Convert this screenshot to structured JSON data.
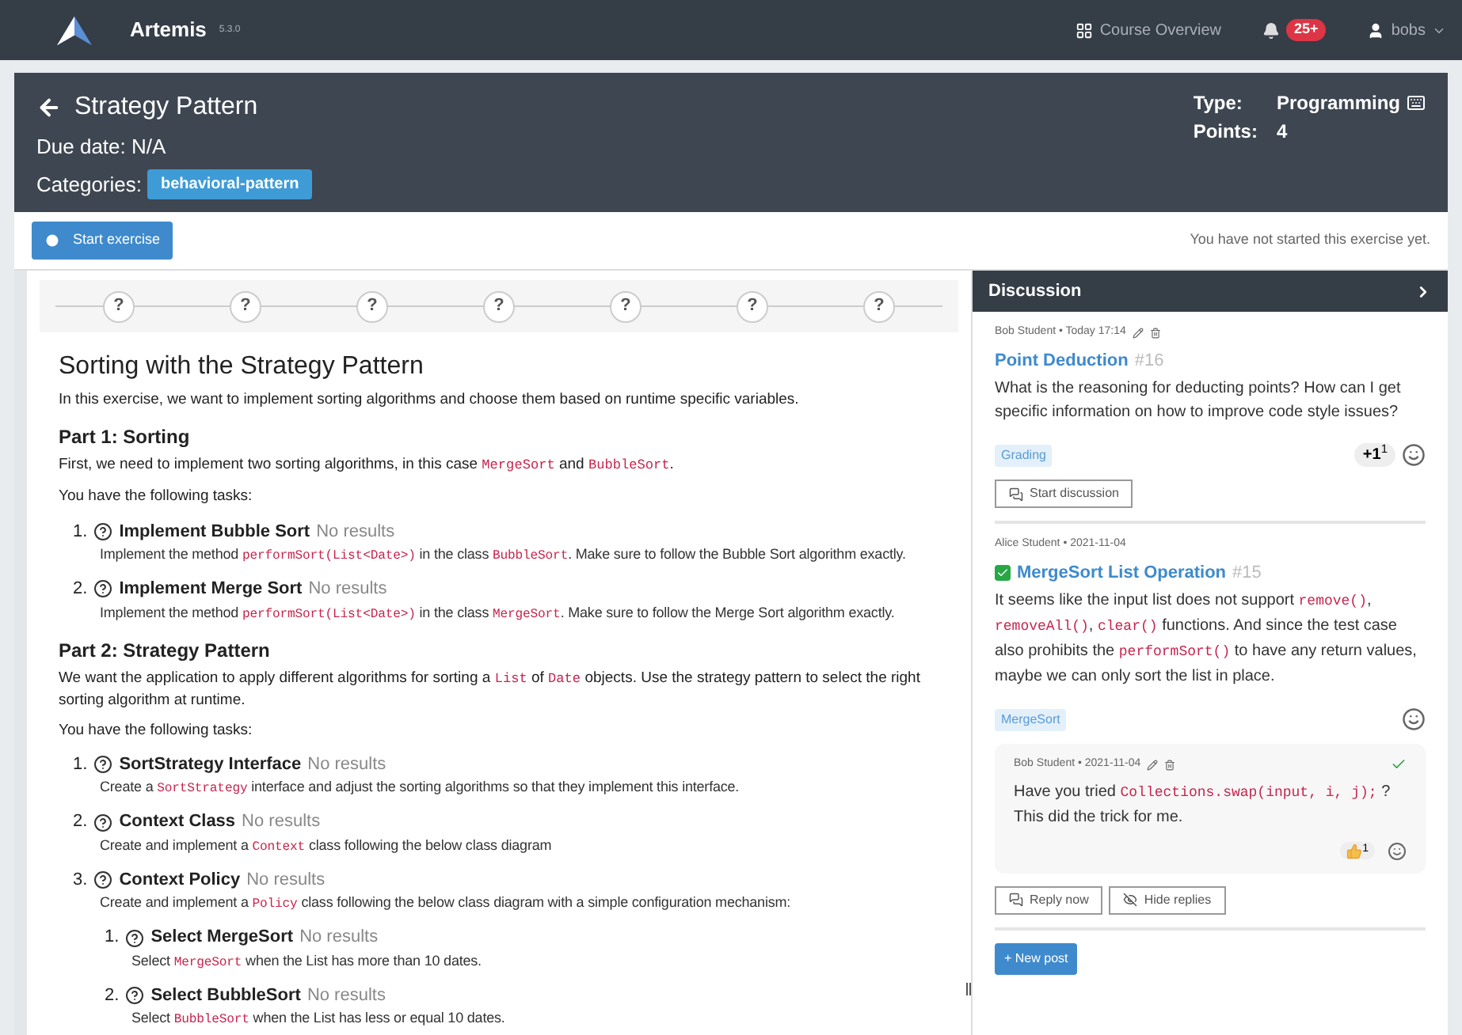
{
  "navbar": {
    "brand": "Artemis",
    "version": "5.3.0",
    "links": [
      {
        "kind": "overview",
        "label": "Course Overview"
      },
      {
        "kind": "notifications",
        "badge": "25+"
      },
      {
        "kind": "user",
        "label": "bobs"
      }
    ]
  },
  "header": {
    "title": "Strategy Pattern",
    "due": "Due date: N/A",
    "categories_label": "Categories:",
    "categories": [
      "behavioral-pattern"
    ],
    "type_label": "Type:",
    "type_value": "Programming",
    "points_label": "Points:",
    "points_value": "4"
  },
  "action_bar": {
    "button": "Start exercise",
    "status": "You have not started this exercise yet."
  },
  "steps": [
    "?",
    "?",
    "?",
    "?",
    "?",
    "?",
    "?"
  ],
  "problem": {
    "title": "Sorting with the Strategy Pattern",
    "intro": "In this exercise, we want to implement sorting algorithms and choose them based on runtime specific variables.",
    "parts": [
      {
        "heading": "Part 1: Sorting",
        "text": [
          {
            "kind": "text",
            "text": "First, we need to implement two sorting algorithms, in this case "
          },
          {
            "kind": "code",
            "text": "MergeSort"
          },
          {
            "kind": "text",
            "text": " and "
          },
          {
            "kind": "code",
            "text": "BubbleSort"
          },
          {
            "kind": "text",
            "text": "."
          }
        ],
        "tasks_intro": "You have the following tasks:",
        "tasks": [
          {
            "number": "1.",
            "name": "Implement Bubble Sort",
            "status": "No results",
            "description": [
              {
                "kind": "text",
                "text": "Implement the method "
              },
              {
                "kind": "code",
                "text": "performSort(List<Date>)"
              },
              {
                "kind": "text",
                "text": " in the class "
              },
              {
                "kind": "code",
                "text": "BubbleSort"
              },
              {
                "kind": "text",
                "text": ". Make sure to follow the Bubble Sort algorithm exactly."
              }
            ]
          },
          {
            "number": "2.",
            "name": "Implement Merge Sort",
            "status": "No results",
            "description": [
              {
                "kind": "text",
                "text": "Implement the method "
              },
              {
                "kind": "code",
                "text": "performSort(List<Date>)"
              },
              {
                "kind": "text",
                "text": " in the class "
              },
              {
                "kind": "code",
                "text": "MergeSort"
              },
              {
                "kind": "text",
                "text": ". Make sure to follow the Merge Sort algorithm exactly."
              }
            ]
          }
        ]
      },
      {
        "heading": "Part 2: Strategy Pattern",
        "text": [
          {
            "kind": "text",
            "text": "We want the application to apply different algorithms for sorting a "
          },
          {
            "kind": "code",
            "text": "List"
          },
          {
            "kind": "text",
            "text": " of "
          },
          {
            "kind": "code",
            "text": "Date"
          },
          {
            "kind": "text",
            "text": " objects. Use the strategy pattern to select the right sorting algorithm at runtime."
          }
        ],
        "tasks_intro": "You have the following tasks:",
        "tasks": [
          {
            "number": "1.",
            "name": "SortStrategy Interface",
            "status": "No results",
            "description": [
              {
                "kind": "text",
                "text": "Create a "
              },
              {
                "kind": "code",
                "text": "SortStrategy"
              },
              {
                "kind": "text",
                "text": " interface and adjust the sorting algorithms so that they implement this interface."
              }
            ]
          },
          {
            "number": "2.",
            "name": "Context Class",
            "status": "No results",
            "description": [
              {
                "kind": "text",
                "text": "Create and implement a "
              },
              {
                "kind": "code",
                "text": "Context"
              },
              {
                "kind": "text",
                "text": " class following the below class diagram"
              }
            ]
          },
          {
            "number": "3.",
            "name": "Context Policy",
            "status": "No results",
            "description": [
              {
                "kind": "text",
                "text": "Create and implement a "
              },
              {
                "kind": "code",
                "text": "Policy"
              },
              {
                "kind": "text",
                "text": " class following the below class diagram with a simple configuration mechanism:"
              }
            ],
            "children": [
              {
                "number": "1.",
                "name": "Select MergeSort",
                "status": "No results",
                "description": [
                  {
                    "kind": "text",
                    "text": "Select "
                  },
                  {
                    "kind": "code",
                    "text": "MergeSort"
                  },
                  {
                    "kind": "text",
                    "text": " when the List has more than 10 dates."
                  }
                ]
              },
              {
                "number": "2.",
                "name": "Select BubbleSort",
                "status": "No results",
                "description": [
                  {
                    "kind": "text",
                    "text": "Select "
                  },
                  {
                    "kind": "code",
                    "text": "BubbleSort"
                  },
                  {
                    "kind": "text",
                    "text": " when the List has less or equal 10 dates."
                  }
                ]
              }
            ]
          }
        ]
      }
    ]
  },
  "discussion": {
    "title": "Discussion",
    "posts": [
      {
        "meta": "Bob Student • Today 17:14",
        "editable": true,
        "title": "Point Deduction",
        "number": "#16",
        "body": [
          {
            "kind": "text",
            "text": "What is the reasoning for deducting points? How can I get specific information on how to improve code style issues?"
          }
        ],
        "tag": "Grading",
        "reaction": "+1",
        "reaction_count": "1",
        "button": "Start discussion"
      },
      {
        "meta": "Alice Student • 2021-11-04",
        "resolved": true,
        "title": "MergeSort List Operation",
        "number": "#15",
        "body": [
          {
            "kind": "text",
            "text": "It seems like the input list does not support "
          },
          {
            "kind": "code",
            "text": "remove()"
          },
          {
            "kind": "text",
            "text": ", "
          },
          {
            "kind": "code",
            "text": "removeAll()"
          },
          {
            "kind": "text",
            "text": ", "
          },
          {
            "kind": "code",
            "text": "clear()"
          },
          {
            "kind": "text",
            "text": " functions. And since the test case also prohibits the "
          },
          {
            "kind": "code",
            "text": "performSort()"
          },
          {
            "kind": "text",
            "text": " to have any return values, maybe we can only sort the list in place."
          }
        ],
        "tag": "MergeSort",
        "replies": [
          {
            "meta": "Bob Student • 2021-11-04",
            "editable": true,
            "accepted": true,
            "body": [
              {
                "kind": "text",
                "text": "Have you tried "
              },
              {
                "kind": "code",
                "text": "Collections.swap(input, i, j);"
              },
              {
                "kind": "text",
                "text": " ? This did the trick for me."
              }
            ],
            "reaction_count": "1"
          }
        ],
        "buttons": [
          {
            "kind": "reply",
            "label": "Reply now"
          },
          {
            "kind": "hide",
            "label": "Hide replies"
          }
        ]
      }
    ],
    "new_post": "+ New post"
  }
}
